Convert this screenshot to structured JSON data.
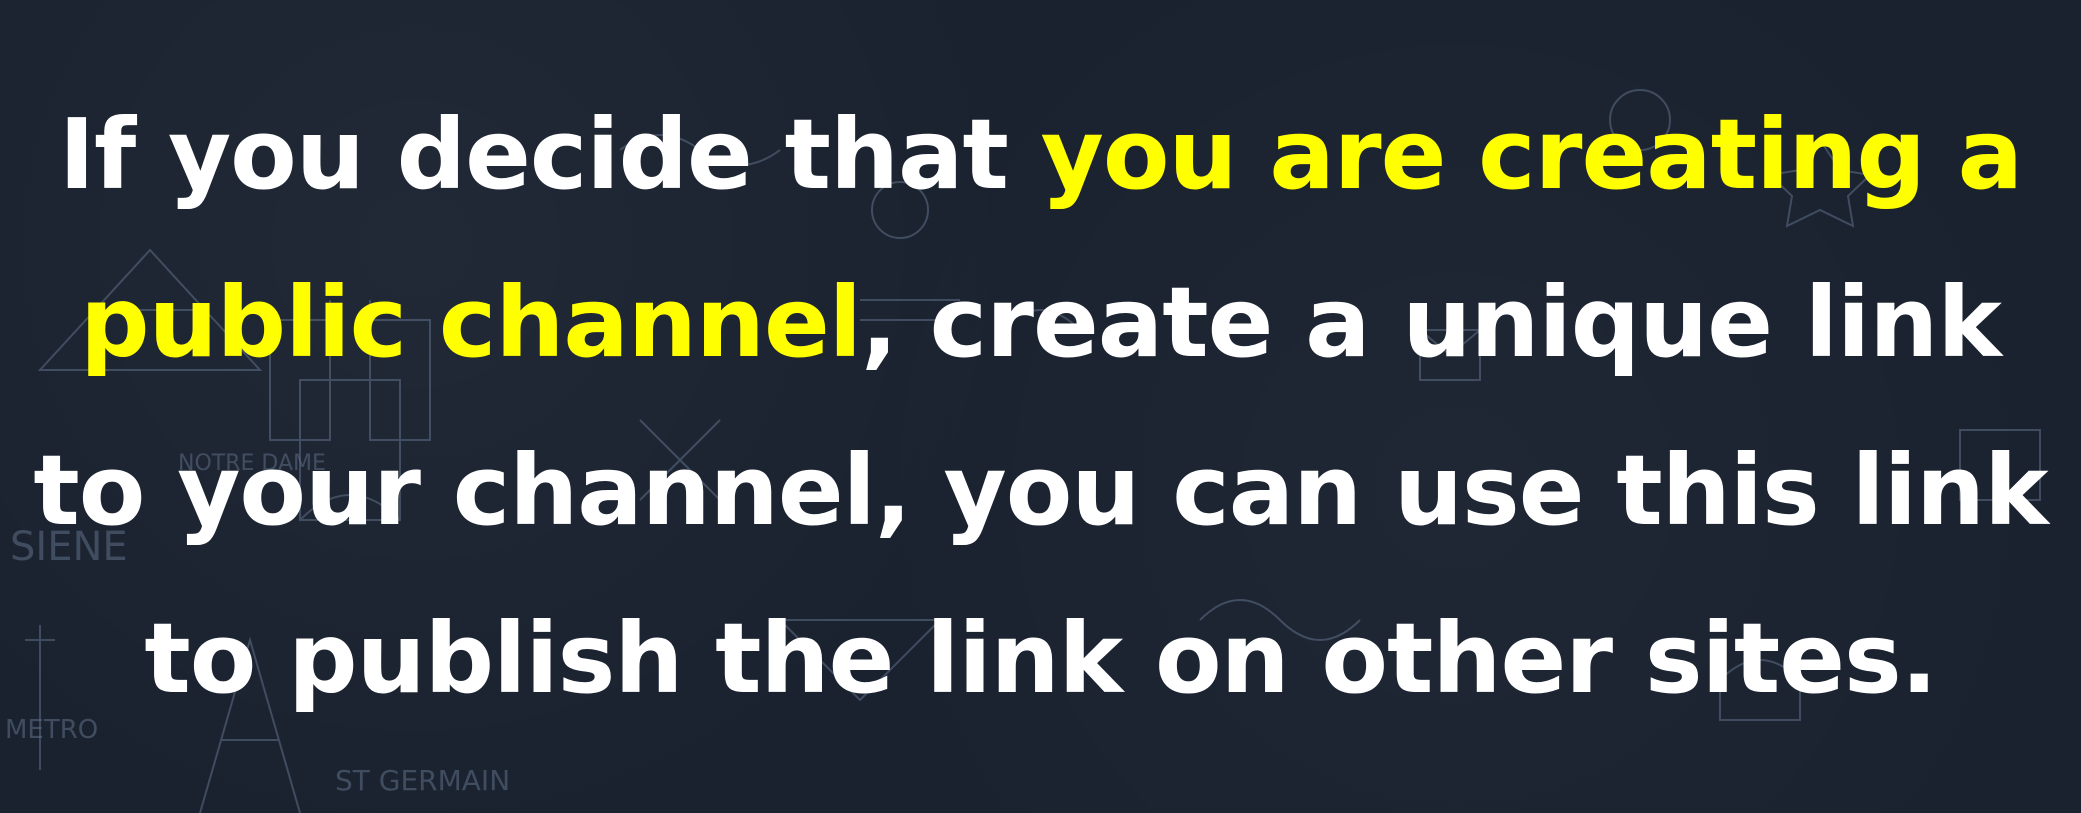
{
  "caption": {
    "intro": "If you decide that ",
    "highlight": "you are creating a public channel",
    "rest": ", create a unique link to your channel, you can use this link to publish the link on other sites."
  },
  "colors": {
    "background": "#1a2230",
    "text": "#ffffff",
    "highlight": "#ffff00",
    "doodle_stroke": "#5f6f86"
  },
  "background_doodle_labels": {
    "notre_dame": "NOTRE DAME",
    "siene": "SIENE",
    "metro": "METRO",
    "st_germain": "ST GERMAIN"
  }
}
